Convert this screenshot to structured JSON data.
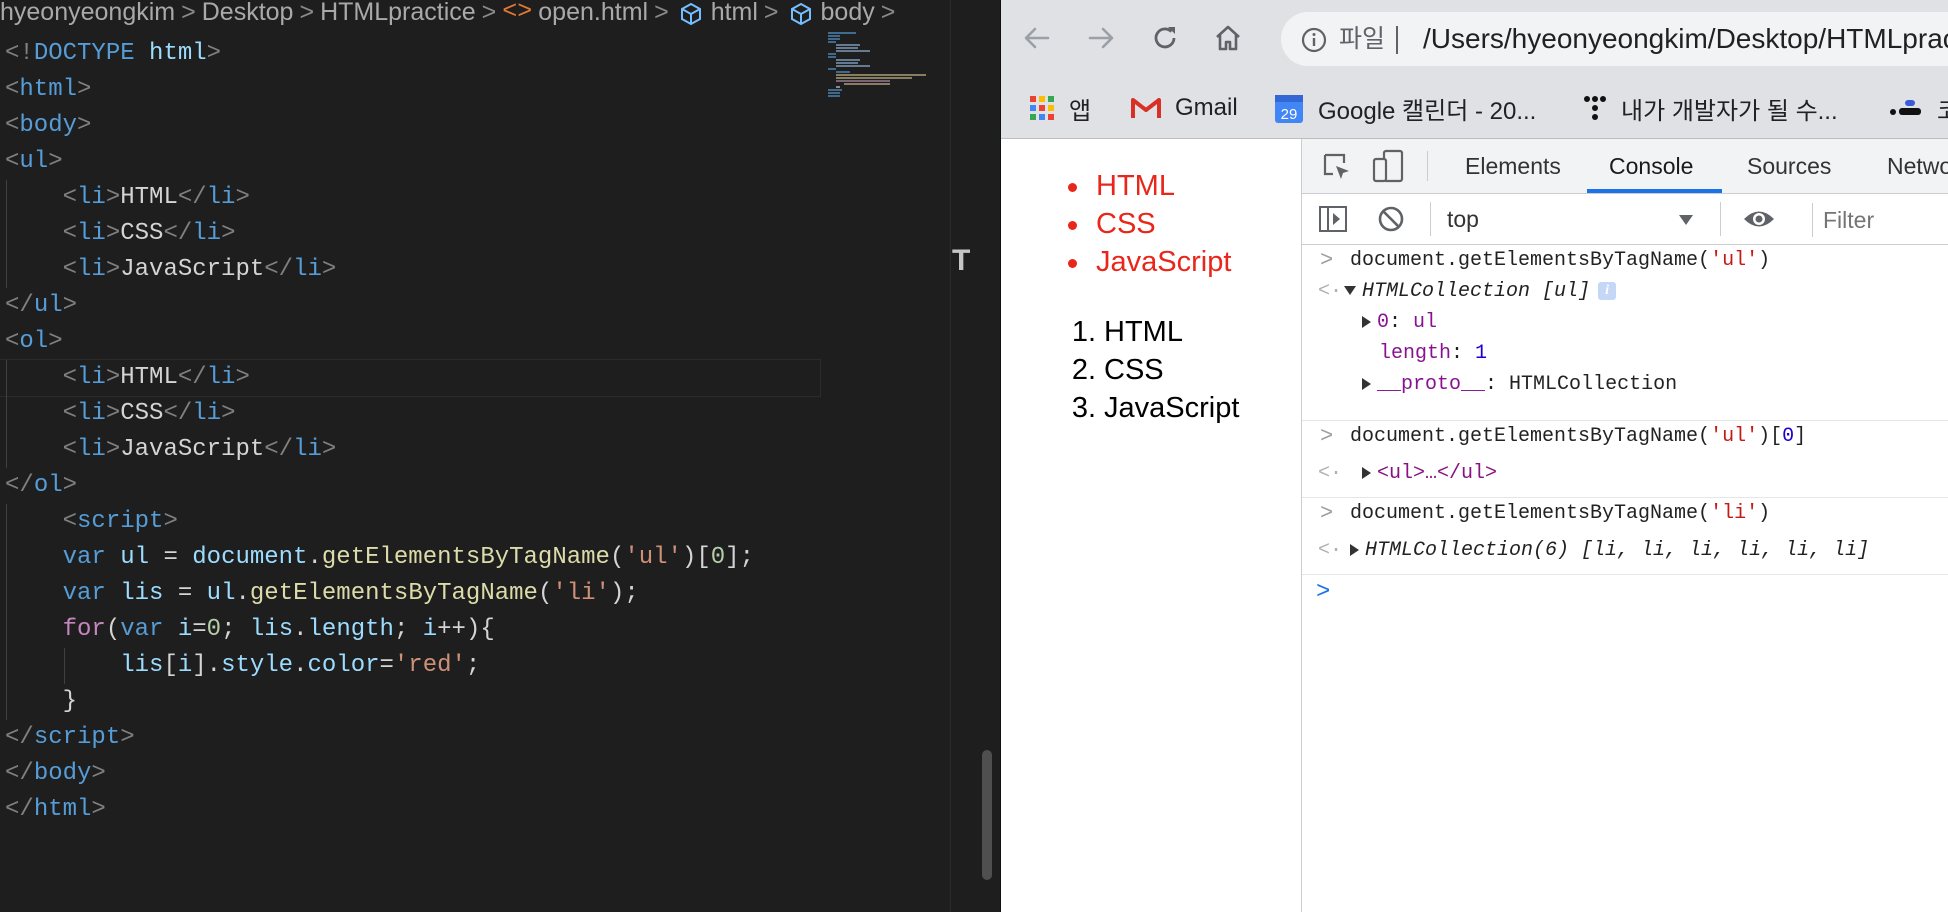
{
  "editor": {
    "breadcrumb": {
      "segments": [
        "hyeonyeongkim",
        "Desktop",
        "HTMLpractice"
      ],
      "file": "open.html",
      "file_icon": "<>",
      "symbols": [
        "html",
        "body"
      ],
      "separator": ">"
    },
    "code_lines": [
      {
        "indent": 0,
        "parts": [
          [
            "br",
            "<!"
          ],
          [
            "tag",
            "DOCTYPE"
          ],
          [
            "txt",
            " "
          ],
          [
            "var",
            "html"
          ],
          [
            "br",
            ">"
          ]
        ]
      },
      {
        "indent": 0,
        "parts": [
          [
            "br",
            "<"
          ],
          [
            "tag",
            "html"
          ],
          [
            "br",
            ">"
          ]
        ]
      },
      {
        "indent": 0,
        "parts": [
          [
            "br",
            "<"
          ],
          [
            "tag",
            "body"
          ],
          [
            "br",
            ">"
          ]
        ]
      },
      {
        "indent": 0,
        "parts": [
          [
            "br",
            "<"
          ],
          [
            "tag",
            "ul"
          ],
          [
            "br",
            ">"
          ]
        ]
      },
      {
        "indent": 1,
        "parts": [
          [
            "br",
            "<"
          ],
          [
            "tag",
            "li"
          ],
          [
            "br",
            ">"
          ],
          [
            "txt",
            "HTML"
          ],
          [
            "br",
            "</"
          ],
          [
            "tag",
            "li"
          ],
          [
            "br",
            ">"
          ]
        ]
      },
      {
        "indent": 1,
        "parts": [
          [
            "br",
            "<"
          ],
          [
            "tag",
            "li"
          ],
          [
            "br",
            ">"
          ],
          [
            "txt",
            "CSS"
          ],
          [
            "br",
            "</"
          ],
          [
            "tag",
            "li"
          ],
          [
            "br",
            ">"
          ]
        ]
      },
      {
        "indent": 1,
        "parts": [
          [
            "br",
            "<"
          ],
          [
            "tag",
            "li"
          ],
          [
            "br",
            ">"
          ],
          [
            "txt",
            "JavaScript"
          ],
          [
            "br",
            "</"
          ],
          [
            "tag",
            "li"
          ],
          [
            "br",
            ">"
          ]
        ]
      },
      {
        "indent": 0,
        "parts": [
          [
            "br",
            "</"
          ],
          [
            "tag",
            "ul"
          ],
          [
            "br",
            ">"
          ]
        ]
      },
      {
        "indent": 0,
        "parts": [
          [
            "br",
            "<"
          ],
          [
            "tag",
            "ol"
          ],
          [
            "br",
            ">"
          ]
        ]
      },
      {
        "indent": 1,
        "current": true,
        "parts": [
          [
            "br",
            "<"
          ],
          [
            "tag",
            "li"
          ],
          [
            "br",
            ">"
          ],
          [
            "txt",
            "HTML"
          ],
          [
            "br",
            "</"
          ],
          [
            "tag",
            "li"
          ],
          [
            "br",
            ">"
          ]
        ]
      },
      {
        "indent": 1,
        "parts": [
          [
            "br",
            "<"
          ],
          [
            "tag",
            "li"
          ],
          [
            "br",
            ">"
          ],
          [
            "txt",
            "CSS"
          ],
          [
            "br",
            "</"
          ],
          [
            "tag",
            "li"
          ],
          [
            "br",
            ">"
          ]
        ]
      },
      {
        "indent": 1,
        "parts": [
          [
            "br",
            "<"
          ],
          [
            "tag",
            "li"
          ],
          [
            "br",
            ">"
          ],
          [
            "txt",
            "JavaScript"
          ],
          [
            "br",
            "</"
          ],
          [
            "tag",
            "li"
          ],
          [
            "br",
            ">"
          ]
        ]
      },
      {
        "indent": 0,
        "parts": [
          [
            "br",
            "</"
          ],
          [
            "tag",
            "ol"
          ],
          [
            "br",
            ">"
          ]
        ]
      },
      {
        "indent": 1,
        "parts": [
          [
            "br",
            "<"
          ],
          [
            "tag",
            "script"
          ],
          [
            "br",
            ">"
          ]
        ]
      },
      {
        "indent": 1,
        "parts": [
          [
            "kw",
            "var"
          ],
          [
            "txt",
            " "
          ],
          [
            "var",
            "ul"
          ],
          [
            "txt",
            " = "
          ],
          [
            "var",
            "document"
          ],
          [
            "txt",
            "."
          ],
          [
            "fn",
            "getElementsByTagName"
          ],
          [
            "txt",
            "("
          ],
          [
            "str",
            "'ul'"
          ],
          [
            "txt",
            ")["
          ],
          [
            "num",
            "0"
          ],
          [
            "txt",
            "];"
          ]
        ]
      },
      {
        "indent": 1,
        "parts": [
          [
            "kw",
            "var"
          ],
          [
            "txt",
            " "
          ],
          [
            "var",
            "lis"
          ],
          [
            "txt",
            " = "
          ],
          [
            "var",
            "ul"
          ],
          [
            "txt",
            "."
          ],
          [
            "fn",
            "getElementsByTagName"
          ],
          [
            "txt",
            "("
          ],
          [
            "str",
            "'li'"
          ],
          [
            "txt",
            ");"
          ]
        ]
      },
      {
        "indent": 1,
        "parts": [
          [
            "ctl",
            "for"
          ],
          [
            "txt",
            "("
          ],
          [
            "kw",
            "var"
          ],
          [
            "txt",
            " "
          ],
          [
            "var",
            "i"
          ],
          [
            "txt",
            "="
          ],
          [
            "num",
            "0"
          ],
          [
            "txt",
            "; "
          ],
          [
            "var",
            "lis"
          ],
          [
            "txt",
            "."
          ],
          [
            "prop",
            "length"
          ],
          [
            "txt",
            "; "
          ],
          [
            "var",
            "i"
          ],
          [
            "txt",
            "++){"
          ]
        ]
      },
      {
        "indent": 2,
        "parts": [
          [
            "var",
            "lis"
          ],
          [
            "txt",
            "["
          ],
          [
            "var",
            "i"
          ],
          [
            "txt",
            "]."
          ],
          [
            "prop",
            "style"
          ],
          [
            "txt",
            "."
          ],
          [
            "prop",
            "color"
          ],
          [
            "txt",
            "="
          ],
          [
            "str",
            "'red'"
          ],
          [
            "txt",
            ";"
          ]
        ]
      },
      {
        "indent": 1,
        "parts": [
          [
            "txt",
            "}"
          ]
        ]
      },
      {
        "indent": 0,
        "parts": [
          [
            "br",
            "</"
          ],
          [
            "tag",
            "script"
          ],
          [
            "br",
            ">"
          ]
        ]
      },
      {
        "indent": 0,
        "parts": [
          [
            "br",
            "</"
          ],
          [
            "tag",
            "body"
          ],
          [
            "br",
            ">"
          ]
        ]
      },
      {
        "indent": 0,
        "parts": [
          [
            "br",
            "</"
          ],
          [
            "tag",
            "html"
          ],
          [
            "br",
            ">"
          ]
        ]
      }
    ],
    "overview_mark": "T"
  },
  "browser": {
    "address": {
      "label": "파일",
      "url": "/Users/hyeonyeongkim/Desktop/HTMLpractice/open.html"
    },
    "bookmarks": [
      {
        "label": "앱",
        "icon": "apps-grid-icon"
      },
      {
        "label": "Gmail",
        "icon": "gmail-icon"
      },
      {
        "label": "Google 캘린더 - 20...",
        "icon": "calendar-icon",
        "calendar_day": "29"
      },
      {
        "label": "내가 개발자가 될 수...",
        "icon": "dots-logo-icon"
      },
      {
        "label": "코",
        "icon": "dev-logo-icon"
      }
    ],
    "page": {
      "ul_items": [
        "HTML",
        "CSS",
        "JavaScript"
      ],
      "ol_items": [
        "HTML",
        "CSS",
        "JavaScript"
      ],
      "ol_numbers": [
        "1.",
        "2.",
        "3."
      ],
      "ul_color": "#e8261a"
    },
    "devtools": {
      "tabs": [
        "Elements",
        "Console",
        "Sources",
        "Network"
      ],
      "active_tab": "Console",
      "context": "top",
      "filter_placeholder": "Filter",
      "console": {
        "cmd1": "document.getElementsByTagName(",
        "cmd1_arg": "'ul'",
        "cmd1_end": ")",
        "res1_label": "HTMLCollection [ul]",
        "res1_info": "i",
        "res1_item_key": "0",
        "res1_item_val": "ul",
        "res1_length_key": "length",
        "res1_length_val": "1",
        "res1_proto_key": "__proto__",
        "res1_proto_val": "HTMLCollection",
        "cmd2_prefix": "document.getElementsByTagName(",
        "cmd2_arg": "'ul'",
        "cmd2_mid": ")[",
        "cmd2_index": "0",
        "cmd2_end": "]",
        "res2": "<ul>…</ul>",
        "cmd3_prefix": "document.getElementsByTagName(",
        "cmd3_arg": "'li'",
        "cmd3_end": ")",
        "res3": "HTMLCollection(6) [li, li, li, li, li, li]"
      }
    }
  }
}
